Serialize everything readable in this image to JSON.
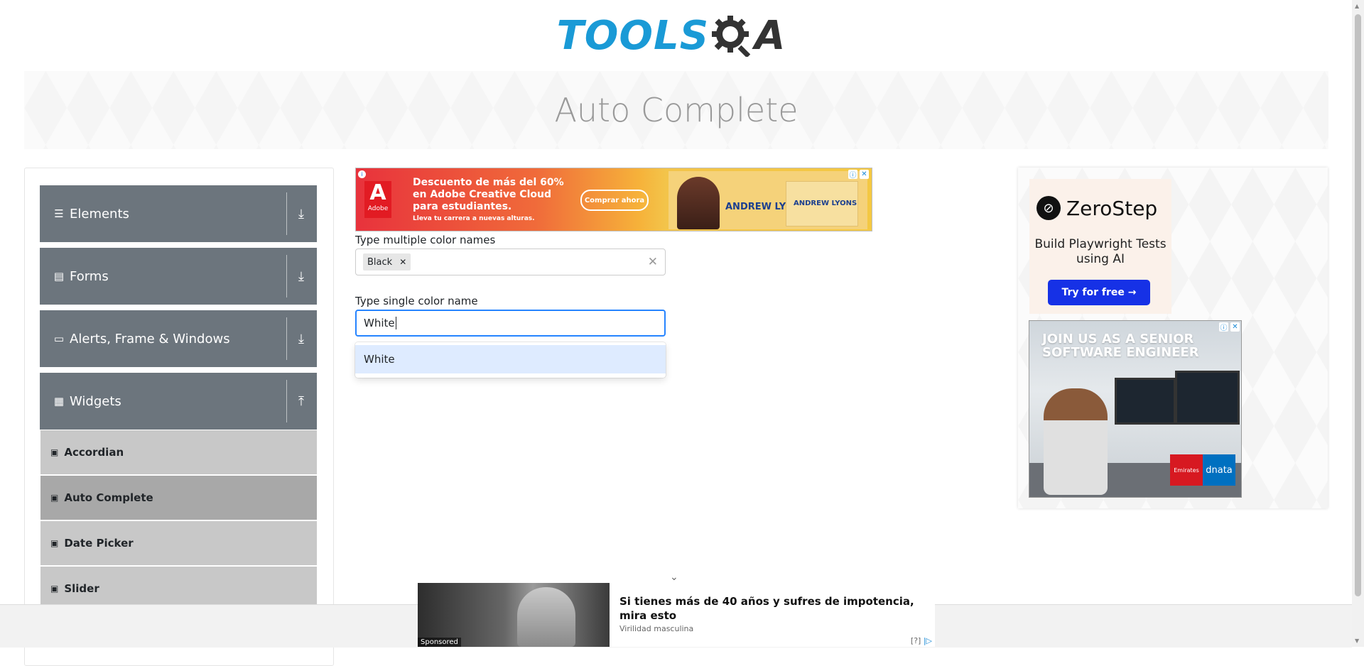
{
  "header": {
    "logo_tools": "TOOLS",
    "logo_qa": "A"
  },
  "page": {
    "title": "Auto Complete"
  },
  "sidebar": {
    "groups": [
      {
        "label": "Elements",
        "icon": "hamburger-icon"
      },
      {
        "label": "Forms",
        "icon": "form-icon"
      },
      {
        "label": "Alerts, Frame & Windows",
        "icon": "window-icon"
      },
      {
        "label": "Widgets",
        "icon": "widgets-icon"
      }
    ],
    "widget_items": [
      {
        "label": "Accordian"
      },
      {
        "label": "Auto Complete",
        "active": true
      },
      {
        "label": "Date Picker"
      },
      {
        "label": "Slider"
      }
    ]
  },
  "main": {
    "ad_top": {
      "adobe_letter": "A",
      "adobe_name": "Adobe",
      "headline": "Descuento de más del 60% en Adobe Creative Cloud para estudiantes.",
      "subtext": "Lleva tu carrera a nuevas alturas.",
      "cta": "Comprar ahora",
      "name_tag": "ANDREW LYONS"
    },
    "multi": {
      "label": "Type multiple color names",
      "chips": [
        "Black"
      ]
    },
    "single": {
      "label": "Type single color name",
      "value": "White",
      "options": [
        "White"
      ]
    }
  },
  "right_ads": {
    "zerostep": {
      "brand": "ZeroStep",
      "tagline": "Build Playwright Tests using AI",
      "cta": "Try for free →"
    },
    "emirates": {
      "headline": "JOIN US AS A SENIOR SOFTWARE ENGINEER",
      "logo1": "Emirates",
      "logo2": "dnata"
    }
  },
  "sponsored": {
    "headline": "Si tienes más de 40 años y sufres de impotencia, mira esto",
    "source": "Virilidad masculina",
    "tag": "Sponsored",
    "help": "[?]"
  },
  "colors": {
    "accent": "#2684ff",
    "sidebar_header": "#6c757d",
    "logo_blue": "#1a9ad6"
  }
}
